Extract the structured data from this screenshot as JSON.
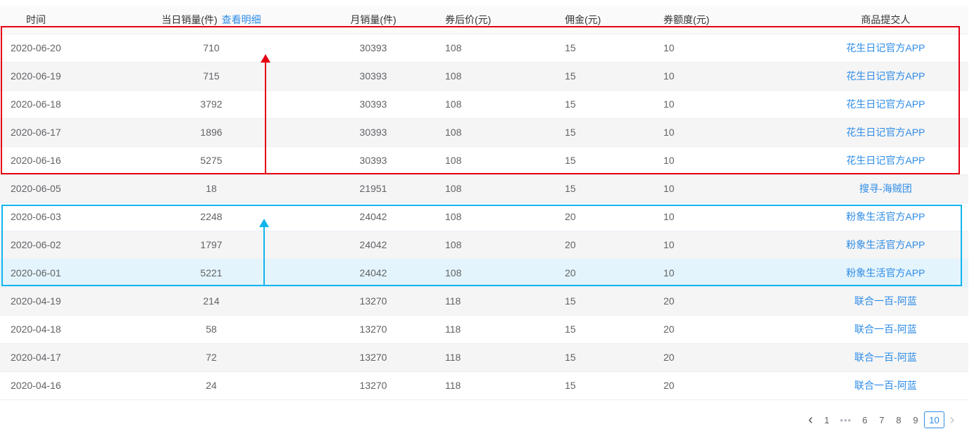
{
  "table": {
    "headers": {
      "date": "时间",
      "daily": "当日销量(件)",
      "detail_link": "查看明细",
      "monthly": "月销量(件)",
      "price": "券后价(元)",
      "commission": "佣金(元)",
      "coupon": "券额度(元)",
      "submitter": "商品提交人"
    },
    "rows": [
      {
        "date": "2020-06-20",
        "daily": "710",
        "monthly": "30393",
        "price": "108",
        "commission": "15",
        "coupon": "10",
        "submitter": "花生日记官方APP"
      },
      {
        "date": "2020-06-19",
        "daily": "715",
        "monthly": "30393",
        "price": "108",
        "commission": "15",
        "coupon": "10",
        "submitter": "花生日记官方APP"
      },
      {
        "date": "2020-06-18",
        "daily": "3792",
        "monthly": "30393",
        "price": "108",
        "commission": "15",
        "coupon": "10",
        "submitter": "花生日记官方APP"
      },
      {
        "date": "2020-06-17",
        "daily": "1896",
        "monthly": "30393",
        "price": "108",
        "commission": "15",
        "coupon": "10",
        "submitter": "花生日记官方APP"
      },
      {
        "date": "2020-06-16",
        "daily": "5275",
        "monthly": "30393",
        "price": "108",
        "commission": "15",
        "coupon": "10",
        "submitter": "花生日记官方APP"
      },
      {
        "date": "2020-06-05",
        "daily": "18",
        "monthly": "21951",
        "price": "108",
        "commission": "15",
        "coupon": "10",
        "submitter": "搜寻-海贼团"
      },
      {
        "date": "2020-06-03",
        "daily": "2248",
        "monthly": "24042",
        "price": "108",
        "commission": "20",
        "coupon": "10",
        "submitter": "粉象生活官方APP"
      },
      {
        "date": "2020-06-02",
        "daily": "1797",
        "monthly": "24042",
        "price": "108",
        "commission": "20",
        "coupon": "10",
        "submitter": "粉象生活官方APP"
      },
      {
        "date": "2020-06-01",
        "daily": "5221",
        "monthly": "24042",
        "price": "108",
        "commission": "20",
        "coupon": "10",
        "submitter": "粉象生活官方APP"
      },
      {
        "date": "2020-04-19",
        "daily": "214",
        "monthly": "13270",
        "price": "118",
        "commission": "15",
        "coupon": "20",
        "submitter": "联合一百-阿蓝"
      },
      {
        "date": "2020-04-18",
        "daily": "58",
        "monthly": "13270",
        "price": "118",
        "commission": "15",
        "coupon": "20",
        "submitter": "联合一百-阿蓝"
      },
      {
        "date": "2020-04-17",
        "daily": "72",
        "monthly": "13270",
        "price": "118",
        "commission": "15",
        "coupon": "20",
        "submitter": "联合一百-阿蓝"
      },
      {
        "date": "2020-04-16",
        "daily": "24",
        "monthly": "13270",
        "price": "118",
        "commission": "15",
        "coupon": "20",
        "submitter": "联合一百-阿蓝"
      }
    ]
  },
  "pagination": {
    "prev_icon": "chevron-left-icon",
    "next_icon": "chevron-right-icon",
    "first": "1",
    "ellipsis": "•••",
    "pages": [
      "6",
      "7",
      "8",
      "9"
    ],
    "current": "10"
  },
  "colors": {
    "link": "#2e8ce6",
    "red_annotation": "#e60012",
    "blue_annotation": "#12b4ec"
  }
}
